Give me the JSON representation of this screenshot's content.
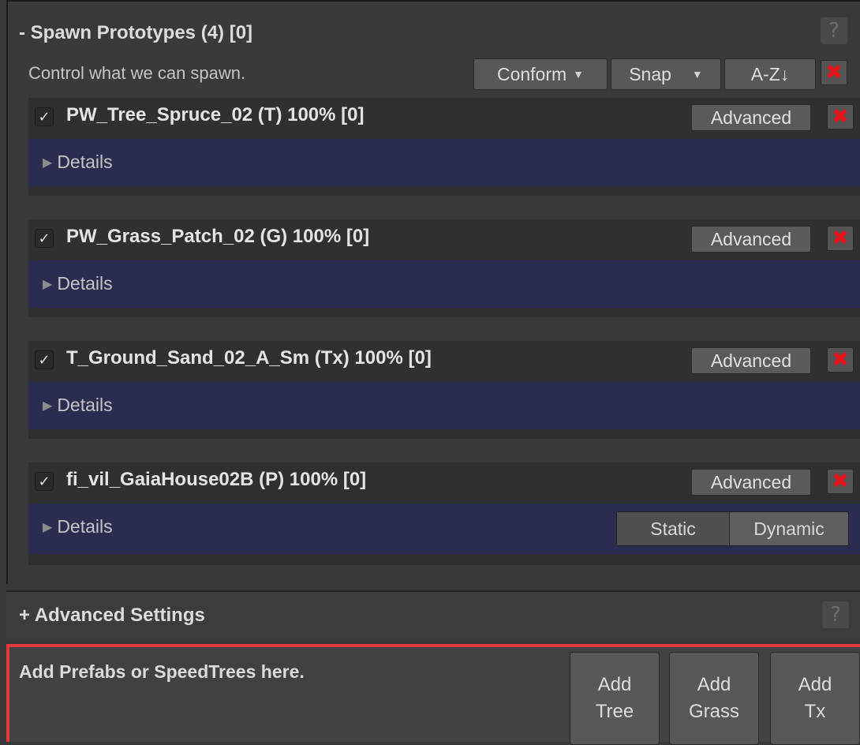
{
  "panel": {
    "title": "- Spawn Prototypes (4) [0]",
    "subtitle": "Control what we can spawn.",
    "help_label": "?",
    "conform_label": "Conform",
    "snap_label": "Snap",
    "sort_label": "A-Z↓",
    "remove_label": "✖"
  },
  "prototypes": [
    {
      "checked_glyph": "✓",
      "name": "PW_Tree_Spruce_02 (T) 100% [0]",
      "advanced_label": "Advanced",
      "details_label": "Details"
    },
    {
      "checked_glyph": "✓",
      "name": "PW_Grass_Patch_02 (G) 100% [0]",
      "advanced_label": "Advanced",
      "details_label": "Details"
    },
    {
      "checked_glyph": "✓",
      "name": "T_Ground_Sand_02_A_Sm (Tx) 100% [0]",
      "advanced_label": "Advanced",
      "details_label": "Details"
    },
    {
      "checked_glyph": "✓",
      "name": "fi_vil_GaiaHouse02B (P) 100% [0]",
      "advanced_label": "Advanced",
      "details_label": "Details",
      "static_label": "Static",
      "dynamic_label": "Dynamic"
    }
  ],
  "advanced_settings": {
    "title": "+ Advanced Settings",
    "help_label": "?"
  },
  "drop_zone": {
    "message": "Add Prefabs or SpeedTrees here.",
    "add_tree": [
      "Add",
      "Tree"
    ],
    "add_grass": [
      "Add",
      "Grass"
    ],
    "add_tx": [
      "Add",
      "Tx"
    ]
  },
  "colors": {
    "accent_red": "#e8141a",
    "details_bg": "#2a2d50",
    "highlight_border": "#e23a3a"
  }
}
